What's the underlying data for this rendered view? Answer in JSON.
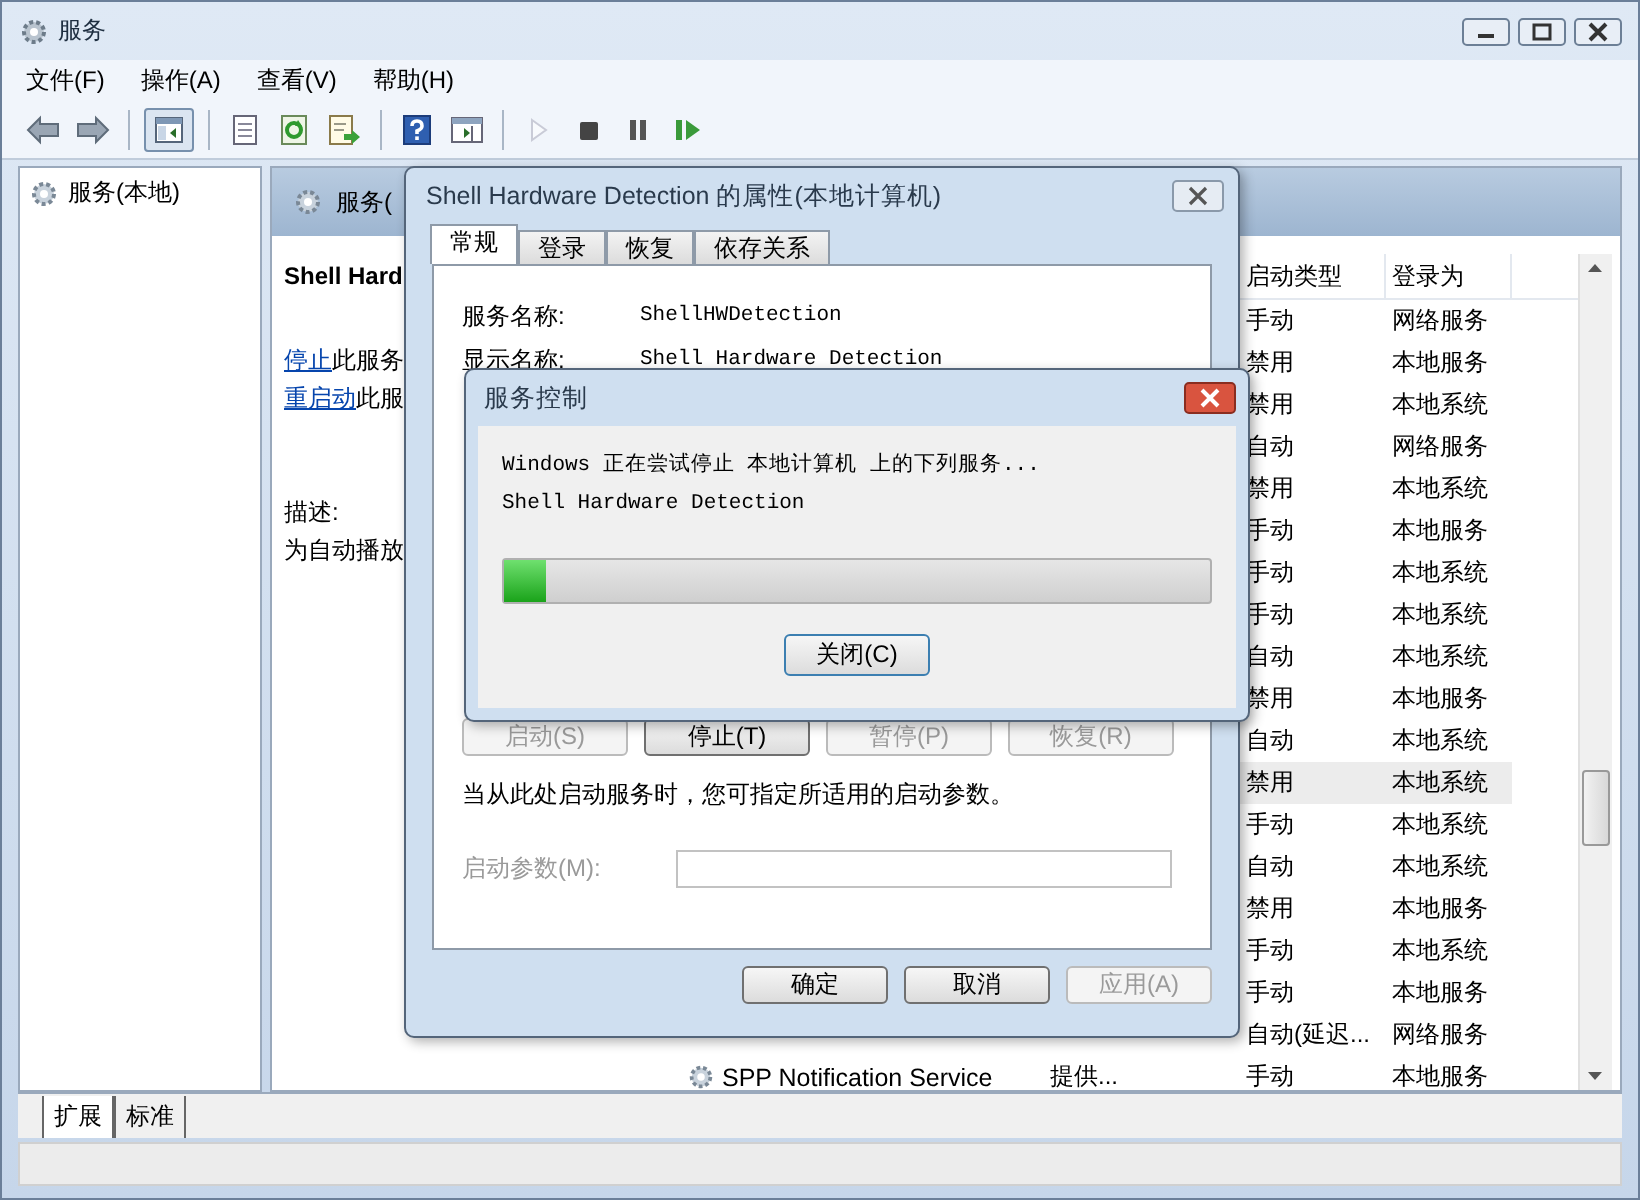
{
  "window": {
    "title": "服务"
  },
  "menu": [
    {
      "label": "文件(F)"
    },
    {
      "label": "操作(A)"
    },
    {
      "label": "查看(V)"
    },
    {
      "label": "帮助(H)"
    }
  ],
  "toolbar": {
    "groups": [
      {
        "buttons": [
          {
            "kind": "back",
            "disabled": false,
            "pressed": false
          },
          {
            "kind": "forward",
            "disabled": false,
            "pressed": false
          }
        ]
      },
      {
        "buttons": [
          {
            "kind": "tree",
            "disabled": false,
            "pressed": true
          }
        ]
      },
      {
        "buttons": [
          {
            "kind": "properties",
            "disabled": false,
            "pressed": false
          },
          {
            "kind": "refresh",
            "disabled": false,
            "pressed": false
          },
          {
            "kind": "export",
            "disabled": false,
            "pressed": false
          }
        ]
      },
      {
        "buttons": [
          {
            "kind": "help",
            "disabled": false,
            "pressed": false
          },
          {
            "kind": "view",
            "disabled": false,
            "pressed": false
          }
        ]
      },
      {
        "buttons": [
          {
            "kind": "start",
            "disabled": true,
            "pressed": false
          },
          {
            "kind": "stop",
            "disabled": false,
            "pressed": false
          },
          {
            "kind": "pause",
            "disabled": false,
            "pressed": false
          },
          {
            "kind": "resume",
            "disabled": false,
            "pressed": false
          }
        ]
      }
    ]
  },
  "tree": {
    "items": [
      {
        "label": "服务(本地)"
      }
    ]
  },
  "services_panel": {
    "header": "服务(",
    "detail": {
      "title": "Shell Hard",
      "actions": [
        {
          "link": "停止",
          "rest": "此服务"
        },
        {
          "link": "重启动",
          "rest": "此服"
        }
      ],
      "description_label": "描述:",
      "description": "为自动播放"
    },
    "columns": [
      "启动类型",
      "登录为"
    ],
    "rows": [
      {
        "startup": "手动",
        "logon": "网络服务",
        "selected": false
      },
      {
        "startup": "禁用",
        "logon": "本地服务",
        "selected": false
      },
      {
        "startup": "禁用",
        "logon": "本地系统",
        "selected": false
      },
      {
        "startup": "自动",
        "logon": "网络服务",
        "selected": false
      },
      {
        "startup": "禁用",
        "logon": "本地系统",
        "selected": false
      },
      {
        "startup": "手动",
        "logon": "本地服务",
        "selected": false
      },
      {
        "startup": "手动",
        "logon": "本地系统",
        "selected": false
      },
      {
        "startup": "手动",
        "logon": "本地系统",
        "selected": false
      },
      {
        "startup": "自动",
        "logon": "本地系统",
        "selected": false
      },
      {
        "startup": "禁用",
        "logon": "本地服务",
        "selected": false
      },
      {
        "startup": "自动",
        "logon": "本地系统",
        "selected": false
      },
      {
        "startup": "禁用",
        "logon": "本地系统",
        "selected": true
      },
      {
        "startup": "手动",
        "logon": "本地系统",
        "selected": false
      },
      {
        "startup": "自动",
        "logon": "本地系统",
        "selected": false
      },
      {
        "startup": "禁用",
        "logon": "本地服务",
        "selected": false
      },
      {
        "startup": "手动",
        "logon": "本地系统",
        "selected": false
      },
      {
        "startup": "手动",
        "logon": "本地服务",
        "selected": false
      },
      {
        "startup": "自动(延迟...",
        "logon": "网络服务",
        "selected": false
      },
      {
        "name": "SPP Notification Service",
        "description": "提供...",
        "startup": "手动",
        "logon": "本地服务",
        "selected": false
      }
    ]
  },
  "view_tabs": [
    {
      "label": "扩展",
      "selected": true
    },
    {
      "label": "标准",
      "selected": false
    }
  ],
  "properties_dialog": {
    "title": "Shell Hardware Detection 的属性(本地计算机)",
    "tabs": [
      {
        "label": "常规",
        "selected": true
      },
      {
        "label": "登录",
        "selected": false
      },
      {
        "label": "恢复",
        "selected": false
      },
      {
        "label": "依存关系",
        "selected": false
      }
    ],
    "fields": [
      {
        "label": "服务名称:",
        "value": "ShellHWDetection"
      },
      {
        "label": "显示名称:",
        "value": "Shell Hardware Detection"
      }
    ],
    "service_buttons": [
      {
        "label": "启动(S)",
        "disabled": true
      },
      {
        "label": "停止(T)",
        "disabled": false
      },
      {
        "label": "暂停(P)",
        "disabled": true
      },
      {
        "label": "恢复(R)",
        "disabled": true
      }
    ],
    "hint": "当从此处启动服务时，您可指定所适用的启动参数。",
    "parameters": {
      "label": "启动参数(M):",
      "disabled": true
    },
    "buttons": [
      {
        "label": "确定",
        "disabled": false
      },
      {
        "label": "取消",
        "disabled": false
      },
      {
        "label": "应用(A)",
        "disabled": true
      }
    ]
  },
  "control_dialog": {
    "title": "服务控制",
    "message": "Windows 正在尝试停止 本地计算机 上的下列服务...",
    "service": "Shell Hardware Detection",
    "progress": {
      "level": 0.06
    },
    "button": "关闭(C)"
  }
}
